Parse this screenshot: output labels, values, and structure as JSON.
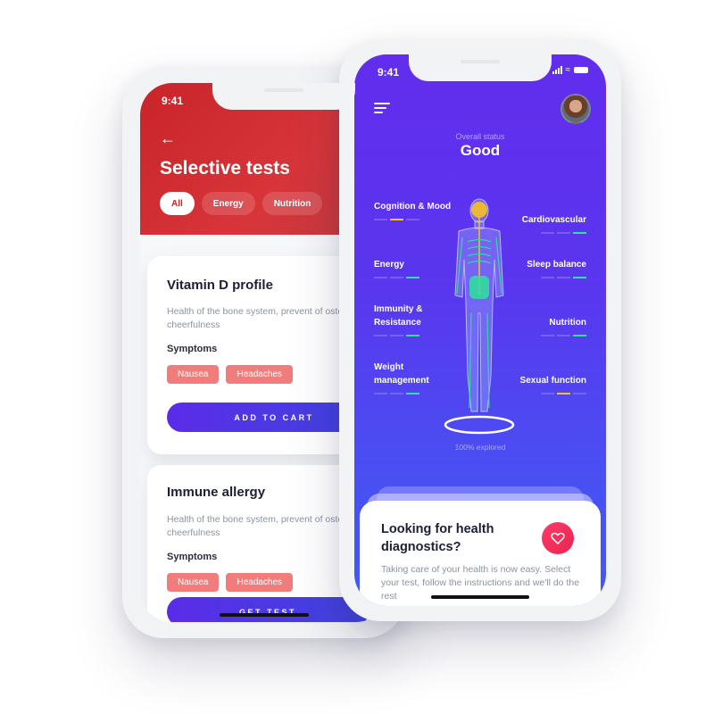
{
  "left_phone": {
    "status_time": "9:41",
    "back_icon": "arrow-left-icon",
    "title": "Selective tests",
    "filters": [
      {
        "label": "All",
        "active": true
      },
      {
        "label": "Energy",
        "active": false
      },
      {
        "label": "Nutrition",
        "active": false
      }
    ],
    "cards": [
      {
        "title": "Vitamin D profile",
        "description": "Health of the bone system, prevent of osteoporosis, cheerfulness",
        "symptoms_label": "Symptoms",
        "symptoms": [
          "Nausea",
          "Headaches"
        ],
        "cta": "ADD TO CART"
      },
      {
        "title": "Immune allergy",
        "description": "Health of the bone system, prevent of osteoporosis, cheerfulness",
        "symptoms_label": "Symptoms",
        "symptoms": [
          "Nausea",
          "Headaches"
        ],
        "cta": "GET TEST"
      }
    ],
    "colors": {
      "header": "#c8242a",
      "tag": "#f07d7b",
      "cta": "#5a2ce8"
    }
  },
  "right_phone": {
    "status_time": "9:41",
    "status_icons": [
      "signal-icon",
      "wifi-icon",
      "battery-icon"
    ],
    "menu_icon": "menu-icon",
    "overall_status_label": "Overall status",
    "overall_status_value": "Good",
    "metrics_left": [
      {
        "label": "Cognition & Mood",
        "level": 2,
        "of": 3,
        "color": "yellow"
      },
      {
        "label": "Energy",
        "level": 3,
        "of": 3,
        "color": "green"
      },
      {
        "label": "Immunity & Resistance",
        "level": 3,
        "of": 3,
        "color": "green"
      },
      {
        "label": "Weight management",
        "level": 3,
        "of": 3,
        "color": "green"
      }
    ],
    "metrics_right": [
      {
        "label": "Cardiovascular",
        "level": 3,
        "of": 3,
        "color": "green"
      },
      {
        "label": "Sleep balance",
        "level": 3,
        "of": 3,
        "color": "green"
      },
      {
        "label": "Nutrition",
        "level": 3,
        "of": 3,
        "color": "green"
      },
      {
        "label": "Sexual function",
        "level": 2,
        "of": 3,
        "color": "yellow"
      }
    ],
    "explored": "100% explored",
    "diagnostics_card": {
      "title": "Looking for health diagnostics?",
      "text": "Taking care of your health is now easy. Select your test, follow the instructions and we'll do the rest",
      "icon": "heart-icon"
    },
    "colors": {
      "background": "#622ded",
      "green": "#2ee39a",
      "yellow": "#f7c11e",
      "heart": "#ff3b6a"
    }
  }
}
